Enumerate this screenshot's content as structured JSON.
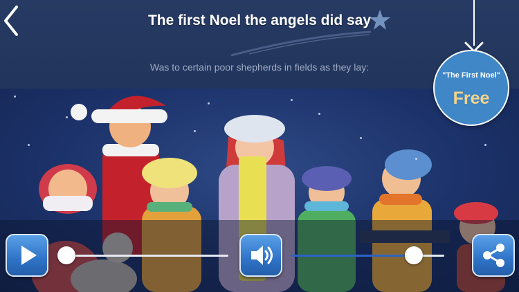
{
  "header": {
    "title": "The first Noel the angels did say",
    "subtitle": "Was to certain poor shepherds in fields as they lay:",
    "back_icon": "chevron-left-icon"
  },
  "badge": {
    "title": "\"The First Noel\"",
    "price": "Free"
  },
  "player": {
    "play_icon": "play-icon",
    "progress": 0.04,
    "volume_icon": "speaker-icon",
    "volume": 0.8,
    "share_icon": "share-icon"
  },
  "colors": {
    "sky": "#23375f",
    "badge": "#3f87c7",
    "price": "#f6d38a",
    "button": "#2f73c7",
    "volume_fill": "#2b63c6"
  }
}
